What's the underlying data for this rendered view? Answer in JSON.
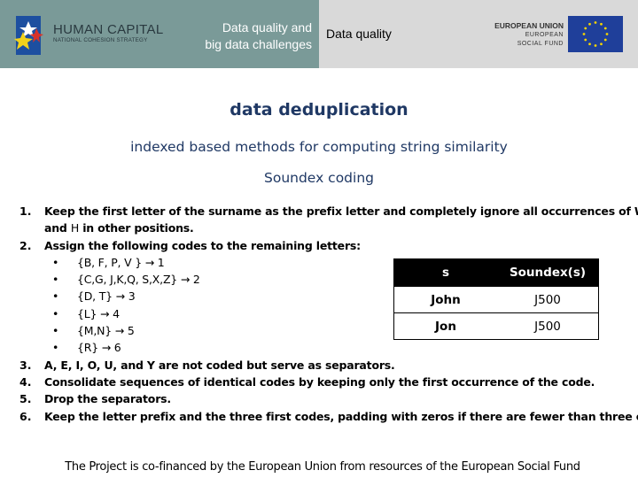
{
  "header": {
    "logo_left": {
      "title": "HUMAN CAPITAL",
      "subtitle": "NATIONAL COHESION STRATEGY"
    },
    "course_title_lines": [
      "Data quality and",
      "big data challenges"
    ],
    "topic": "Data quality",
    "logo_right": {
      "line1": "EUROPEAN UNION",
      "line2": "EUROPEAN",
      "line3": "SOCIAL FUND"
    },
    "colors": {
      "left_bg": "#7a9a98",
      "right_bg": "#d9d9d9",
      "eu_blue": "#1f3f9a",
      "eu_star": "#f5d400"
    }
  },
  "slide": {
    "title": "data deduplication",
    "subtitle": "indexed based methods for computing string similarity",
    "section": "Soundex coding",
    "title_color": "#1f3864"
  },
  "steps": [
    {
      "num": "1.",
      "text": "Keep the first letter of the surname as the prefix letter and completely ignore all occurrences of W",
      "cont_a": "and ",
      "cont_b": "H",
      "cont_c": " in other positions."
    },
    {
      "num": "2.",
      "text": "Assign the following codes to the remaining letters:"
    },
    {
      "num": "3.",
      "text": " A, E, I, O, U, and Y are not coded but serve as separators."
    },
    {
      "num": "4.",
      "text": "Consolidate sequences of identical codes by keeping only the first occurrence of the code."
    },
    {
      "num": "5.",
      "text": "Drop the separators."
    },
    {
      "num": "6.",
      "text": "Keep the letter prefix and the three first codes, padding with zeros if there are fewer than three codes."
    }
  ],
  "codes": [
    {
      "bullet": "•",
      "text": "{B, F, P, V } → 1"
    },
    {
      "bullet": "•",
      "text": "{C,G, J,K,Q, S,X,Z} → 2"
    },
    {
      "bullet": "•",
      "text": "{D, T} → 3"
    },
    {
      "bullet": "•",
      "text": "{L} → 4"
    },
    {
      "bullet": "•",
      "text": "{M,N} → 5"
    },
    {
      "bullet": "•",
      "text": "{R} → 6"
    }
  ],
  "table": {
    "headers": [
      "s",
      "Soundex(s)"
    ],
    "rows": [
      [
        "John",
        "J500"
      ],
      [
        "Jon",
        "J500"
      ]
    ]
  },
  "footer": "The Project is co-financed by the European Union from resources of the European Social Fund"
}
